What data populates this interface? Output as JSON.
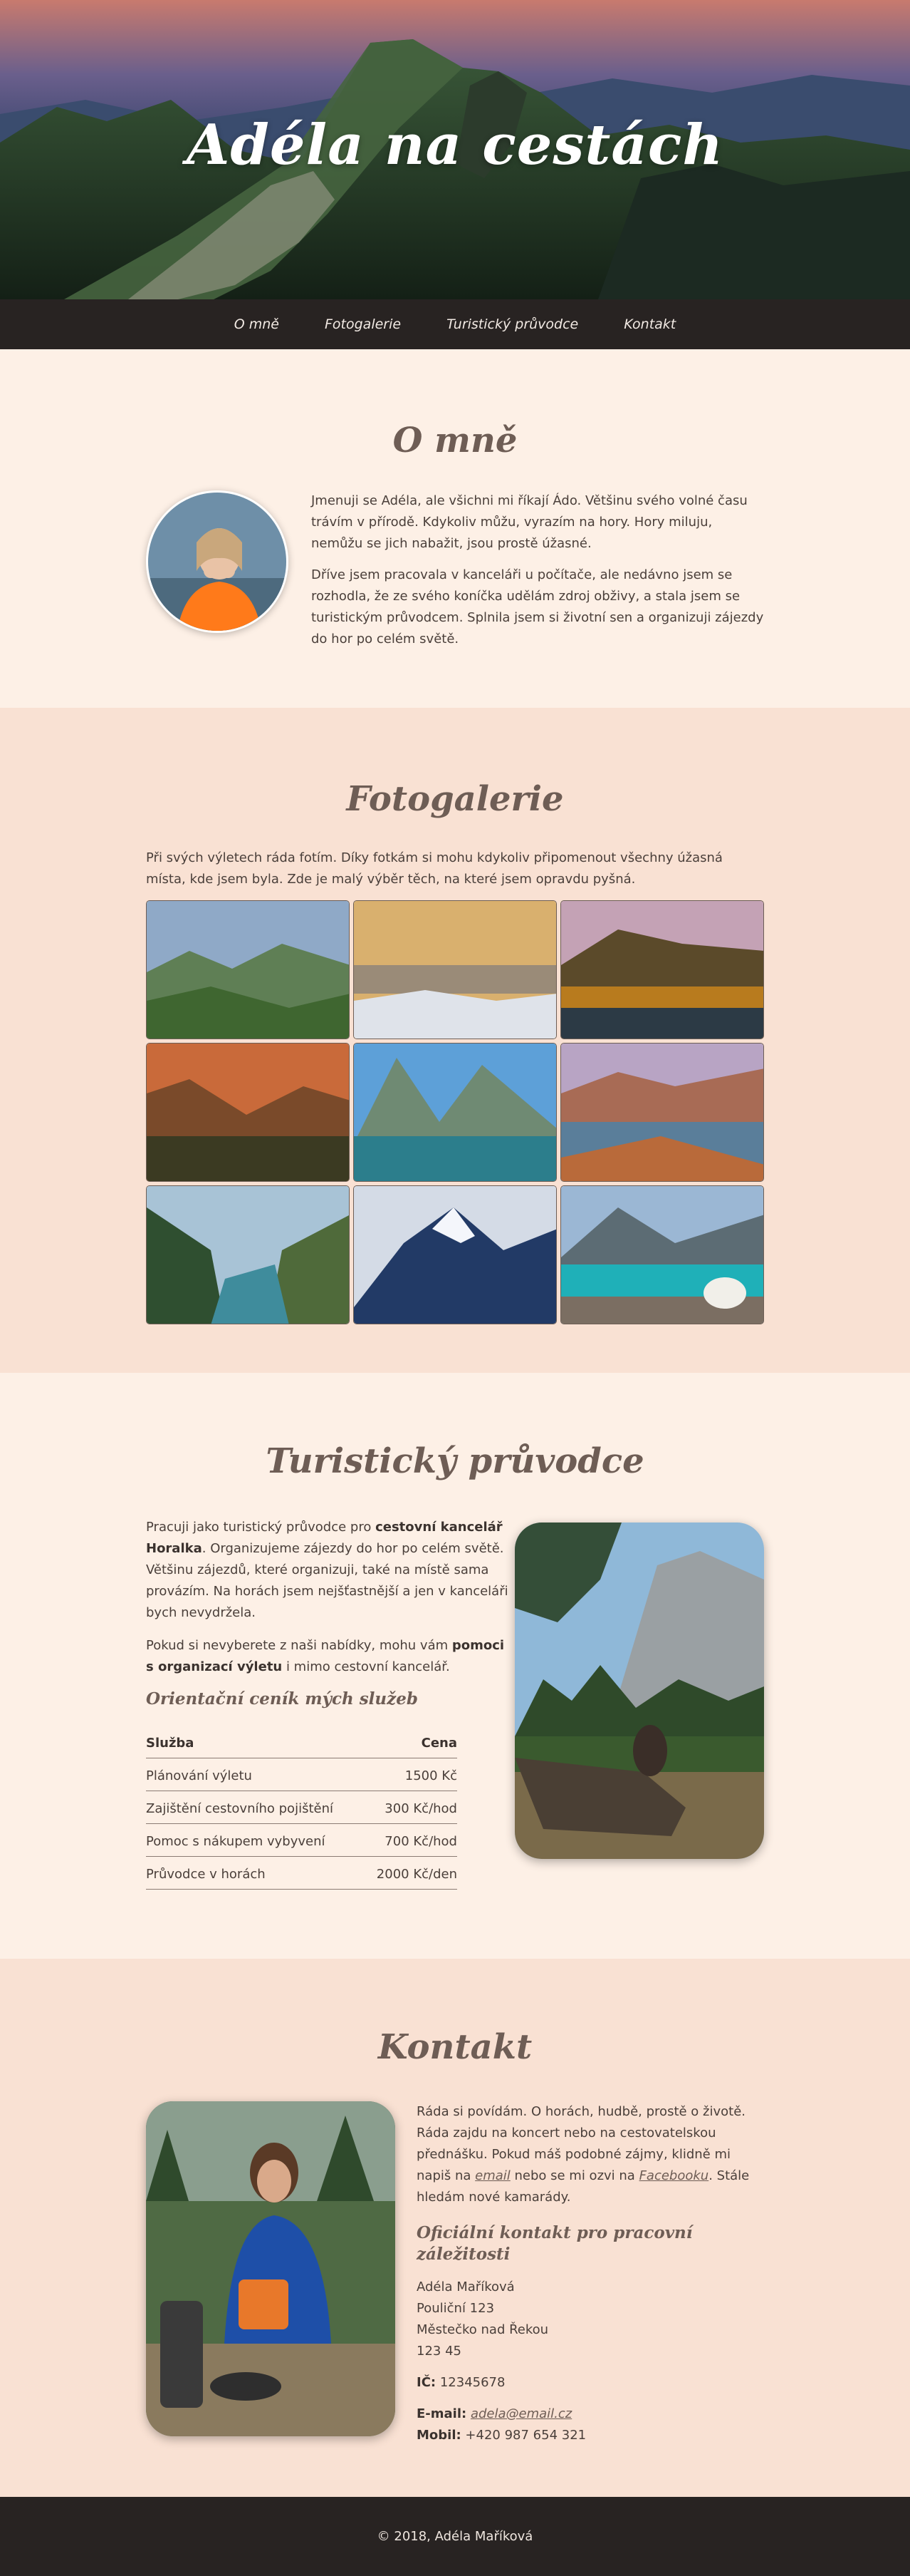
{
  "site": {
    "title": "Adéla na cestách"
  },
  "nav": {
    "items": [
      "O mně",
      "Fotogalerie",
      "Turistický průvodce",
      "Kontakt"
    ]
  },
  "about": {
    "heading": "O mně",
    "paragraphs": [
      "Jmenuji se Adéla, ale všichni mi říkají Ádo. Většinu svého volné času trávím v přírodě. Kdykoliv můžu, vyrazím na hory. Hory miluju, nemůžu se jich nabažit, jsou prostě úžasné.",
      "Dříve jsem pracovala v kanceláři u počítače, ale nedávno jsem se rozhodla, že ze svého koníčka udělám zdroj obživy, a stala jsem se turistickým průvodcem. Splnila jsem si životní sen a organizuji zájezdy do hor po celém světě."
    ]
  },
  "gallery": {
    "heading": "Fotogalerie",
    "lead": "Při svých výletech ráda fotím. Díky fotkám si mohu kdykoliv připomenout všechny úžasná místa, kde jsem byla. Zde je malý výběr těch, na které jsem opravdu pyšná."
  },
  "guide": {
    "heading": "Turistický průvodce",
    "p1_a": "Pracuji jako turistický průvodce pro ",
    "p1_b": "cestovní kancelář Horalka",
    "p1_c": ". Organizujeme zájezdy do hor po celém světě. Většinu zájezdů, které organizuji, také na místě sama provázím. Na horách jsem nejšťastnější a jen v kanceláři bych nevydržela.",
    "p2_a": "Pokud si nevyberete z naši nabídky, mohu vám ",
    "p2_b": "pomoci s organizací výletu",
    "p2_c": " i mimo cestovní kancelář.",
    "price_heading": "Orientační ceník mých služeb",
    "table": {
      "col_service": "Služba",
      "col_price": "Cena",
      "rows": [
        {
          "service": "Plánování výletu",
          "price": "1500 Kč"
        },
        {
          "service": "Zajištění cestovního pojištění",
          "price": "300 Kč/hod"
        },
        {
          "service": "Pomoc s nákupem vybyvení",
          "price": "700 Kč/hod"
        },
        {
          "service": "Průvodce v horách",
          "price": "2000 Kč/den"
        }
      ]
    }
  },
  "contact": {
    "heading": "Kontakt",
    "intro_a": "Ráda si povídám. O horách, hudbě, prostě o životě. Ráda zajdu na koncert nebo na cestovatelskou přednášku. Pokud máš podobné zájmy, klidně mi napiš na ",
    "email_link": "email",
    "intro_b": " nebo se mi ozvi na ",
    "facebook_link": "Facebooku",
    "intro_c": ". Stále hledám nové kamarády.",
    "official_heading": "Oficiální kontakt pro pracovní záležitosti",
    "address": [
      "Adéla Maříková",
      "Pouliční 123",
      "Městečko nad Řekou",
      "123 45"
    ],
    "ic_label": "IČ:",
    "ic_value": " 12345678",
    "email_label": "E-mail:",
    "email_value": "adela@email.cz",
    "phone_label": "Mobil:",
    "phone_value": " +420 987 654 321"
  },
  "footer": {
    "text": "© 2018, Adéla Maříková"
  }
}
